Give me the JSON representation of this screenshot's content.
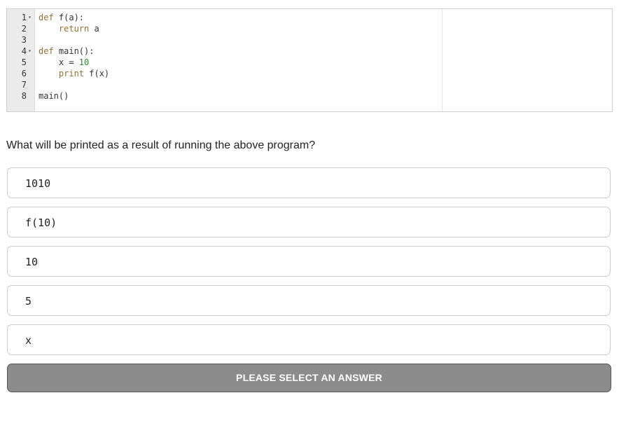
{
  "editor": {
    "lines": [
      {
        "num": "1",
        "fold": true,
        "tokens": [
          {
            "text": "def",
            "kind": "kw"
          },
          {
            "text": " f(a):",
            "kind": "plain"
          }
        ]
      },
      {
        "num": "2",
        "fold": false,
        "tokens": [
          {
            "text": "    ",
            "kind": "plain"
          },
          {
            "text": "return",
            "kind": "kw"
          },
          {
            "text": " a",
            "kind": "plain"
          }
        ]
      },
      {
        "num": "3",
        "fold": false,
        "tokens": []
      },
      {
        "num": "4",
        "fold": true,
        "tokens": [
          {
            "text": "def",
            "kind": "kw"
          },
          {
            "text": " main():",
            "kind": "plain"
          }
        ]
      },
      {
        "num": "5",
        "fold": false,
        "tokens": [
          {
            "text": "    x = ",
            "kind": "plain"
          },
          {
            "text": "10",
            "kind": "num"
          }
        ]
      },
      {
        "num": "6",
        "fold": false,
        "tokens": [
          {
            "text": "    ",
            "kind": "plain"
          },
          {
            "text": "print",
            "kind": "kw"
          },
          {
            "text": " f(x)",
            "kind": "plain"
          }
        ]
      },
      {
        "num": "7",
        "fold": false,
        "tokens": []
      },
      {
        "num": "8",
        "fold": false,
        "tokens": [
          {
            "text": "main()",
            "kind": "plain"
          }
        ]
      }
    ],
    "fold_glyph": "▾"
  },
  "question": {
    "text": "What will be printed as a result of running the above program?"
  },
  "options": [
    {
      "label": "1010"
    },
    {
      "label": "f(10)"
    },
    {
      "label": "10"
    },
    {
      "label": "5"
    },
    {
      "label": "x"
    }
  ],
  "submit": {
    "label": "PLEASE SELECT AN ANSWER"
  },
  "colors": {
    "keyword": "#93702e",
    "number": "#2d8a2d",
    "submit_bg": "#8c8c8c"
  }
}
